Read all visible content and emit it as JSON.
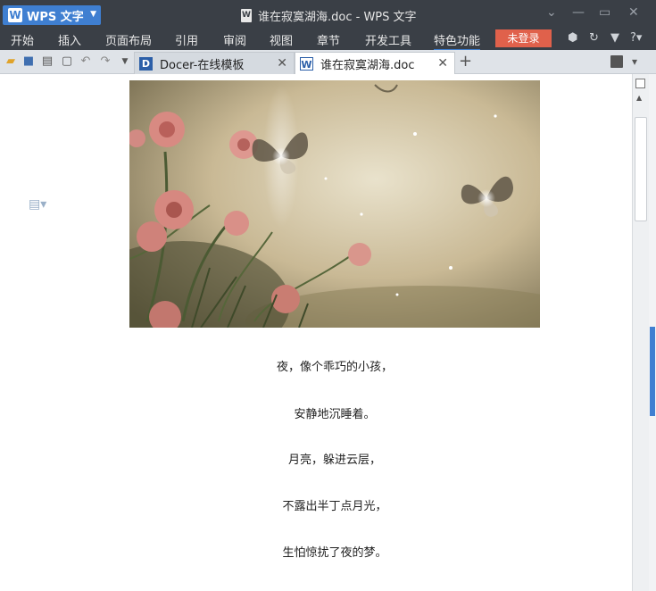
{
  "app": {
    "name": "WPS 文字",
    "window_title": "谁在寂寞湖海.doc - WPS 文字"
  },
  "menu": [
    "开始",
    "插入",
    "页面布局",
    "引用",
    "审阅",
    "视图",
    "章节",
    "开发工具",
    "特色功能"
  ],
  "menu_active": "特色功能",
  "login_label": "未登录",
  "help_label": "?",
  "tabs": [
    {
      "label": "Docer-在线模板",
      "active": false,
      "icon": "docer-icon"
    },
    {
      "label": "谁在寂寞湖海.doc",
      "active": true,
      "icon": "word-doc-icon"
    }
  ],
  "poem": [
    "夜，像个乖巧的小孩，",
    "安静地沉睡着。",
    "月亮，躲进云层，",
    "不露出半丁点月光，",
    "生怕惊扰了夜的梦。"
  ],
  "colors": {
    "titlebar": "#3a3f46",
    "accent": "#3f7fd1",
    "login": "#e0614b"
  }
}
